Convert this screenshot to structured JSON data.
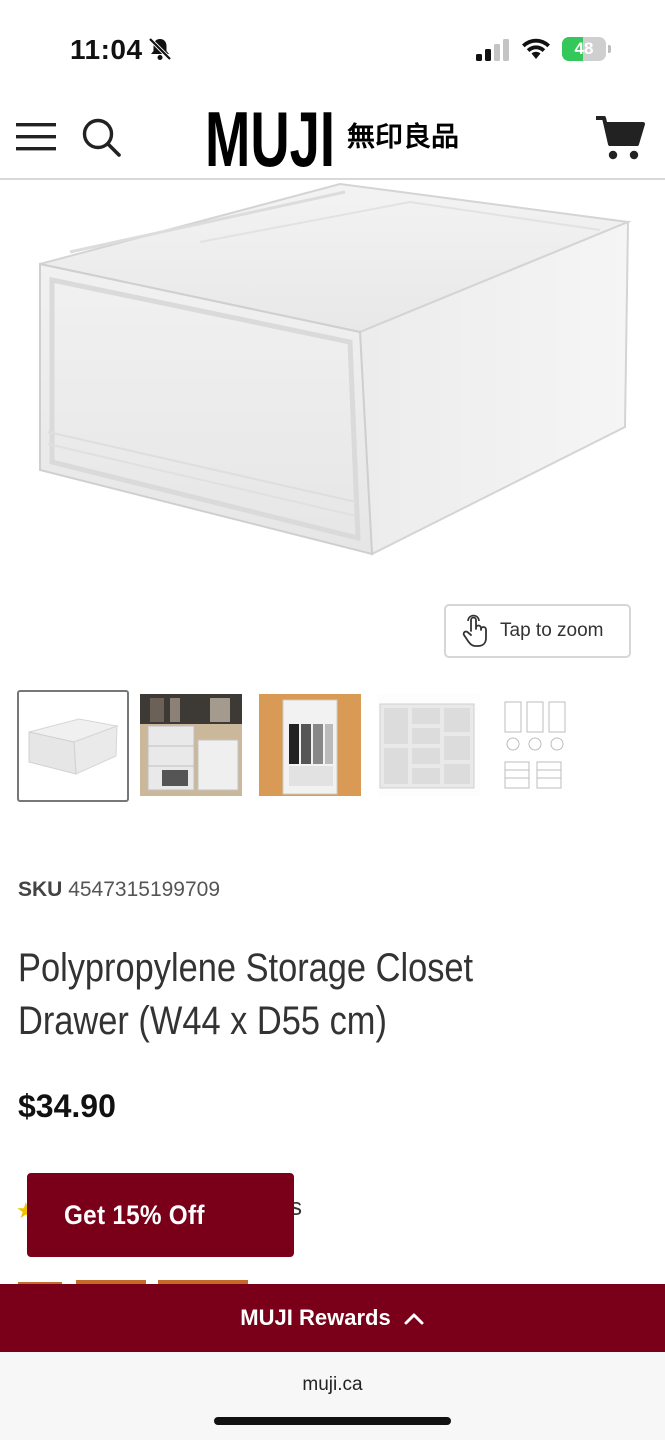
{
  "status_bar": {
    "time": "11:04",
    "battery_percent": "48",
    "battery_level": 0.48,
    "battery_color": "#34c759"
  },
  "header": {
    "logo_text": "MUJI",
    "logo_kanji": "無印良品",
    "icons": [
      "menu-icon",
      "search-icon",
      "cart-icon"
    ]
  },
  "product": {
    "zoom_label": "Tap to zoom",
    "thumbnails": [
      "thumb-drawer",
      "thumb-closet",
      "thumb-drawer-top",
      "thumb-grid",
      "thumb-diagram"
    ],
    "sku_label": "SKU",
    "sku_value": "4547315199709",
    "title": "Polypropylene Storage Closet Drawer (W44 x D55 cm)",
    "price": "$34.90",
    "rating_fragment": "s"
  },
  "promo": {
    "label": "Get 15% Off",
    "color": "#7a0019"
  },
  "rewards": {
    "label": "MUJI Rewards",
    "color": "#7a0019"
  },
  "browser": {
    "url": "muji.ca"
  }
}
